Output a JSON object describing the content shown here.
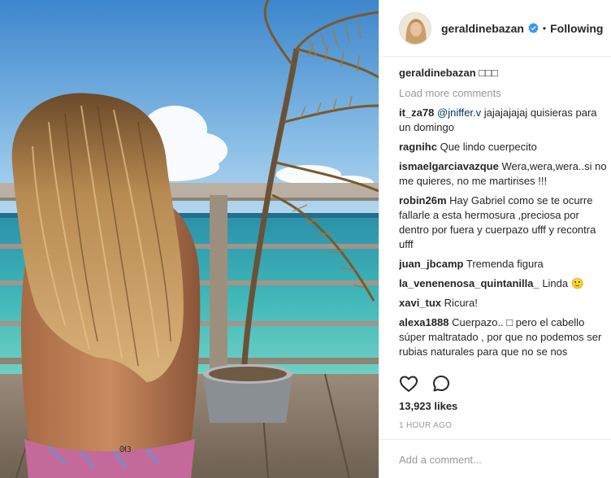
{
  "post": {
    "username": "geraldinebazan",
    "follow_separator": "•",
    "follow_label": "Following",
    "verified_icon": "verified-badge-icon",
    "accent_color": "#3897f0"
  },
  "caption": {
    "username": "geraldinebazan",
    "text": "□□□"
  },
  "load_more_label": "Load more comments",
  "comments": [
    {
      "user": "it_za78",
      "mention": "@jniffer.v",
      "lines": [
        "jajajajajaj quisieras para",
        "un domingo"
      ]
    },
    {
      "user": "ragnihc",
      "lines": [
        "Que lindo cuerpecito"
      ]
    },
    {
      "user": "ismaelgarciavazque",
      "lines": [
        "Wera,wera,wera..si no",
        "me quieres, no me martirises !!!"
      ]
    },
    {
      "user": "robin26m",
      "lines": [
        "Hay Gabriel como se te ocurre",
        "fallarle a esta hermosura ,preciosa por",
        "dentro por fuera y cuerpazo ufff y recontra",
        "ufff"
      ]
    },
    {
      "user": "juan_jbcamp",
      "lines": [
        "Tremenda figura"
      ]
    },
    {
      "user": "la_venenenosa_quintanilla_",
      "lines": [
        "Linda 🙂"
      ]
    },
    {
      "user": "xavi_tux",
      "lines": [
        "Ricura!"
      ]
    },
    {
      "user": "alexa1888",
      "lines": [
        "Cuerpazo.. □ pero el cabello",
        "súper maltratado , por que no podemos ser",
        "rubias naturales para que no se nos"
      ]
    }
  ],
  "actions": {
    "like_icon": "heart-icon",
    "comment_icon": "comment-bubble-icon"
  },
  "likes_label": "13,923 likes",
  "time_label": "1 HOUR AGO",
  "add_comment": {
    "placeholder": "Add a comment..."
  }
}
